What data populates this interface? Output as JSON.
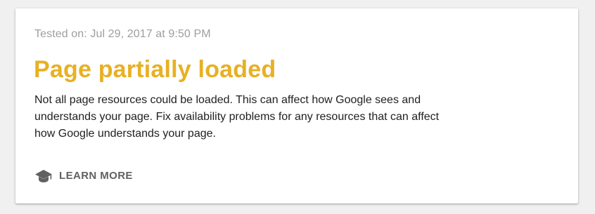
{
  "result": {
    "tested_on": "Tested on: Jul 29, 2017 at 9:50 PM",
    "headline": "Page partially loaded",
    "description": "Not all page resources could be loaded. This can affect how Google sees and understands your page. Fix availability problems for any resources that can affect how Google understands your page."
  },
  "actions": {
    "learn_more_icon": "school-icon",
    "learn_more_label": "LEARN MORE"
  },
  "colors": {
    "headline": "#e8b023",
    "tested_on": "#9e9e9e",
    "description": "#212121",
    "action": "#616161",
    "background": "#f0f0f0",
    "card": "#ffffff"
  }
}
